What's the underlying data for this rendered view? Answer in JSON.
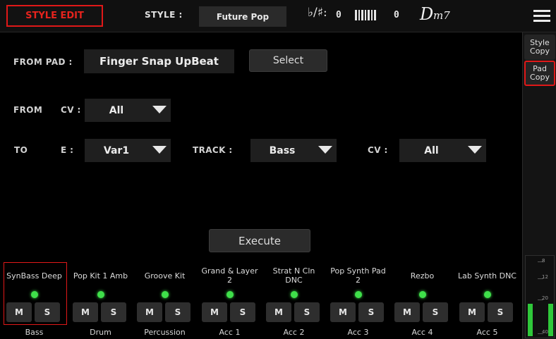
{
  "header": {
    "mode": "STYLE EDIT",
    "style_label": "STYLE :",
    "style_value": "Future Pop",
    "transpose_symbol": "♭/♯:",
    "transpose_value": "0",
    "keyboard_value": "0",
    "chord_root": "D",
    "chord_type": "m7"
  },
  "sidebar": {
    "style_copy": "Style Copy",
    "pad_copy": "Pad Copy",
    "meter_marks": [
      "8",
      "12",
      "20",
      "40"
    ]
  },
  "main": {
    "from_pad_label": "FROM PAD :",
    "from_pad_value": "Finger Snap UpBeat",
    "select_label": "Select",
    "from_label": "FROM",
    "from_cv_label": "CV :",
    "from_cv_value": "All",
    "to_label": "TO",
    "to_e_label": "E :",
    "to_e_value": "Var1",
    "track_label": "TRACK :",
    "track_value": "Bass",
    "to_cv_label": "CV :",
    "to_cv_value": "All",
    "execute_label": "Execute"
  },
  "mixer": {
    "mute_label": "M",
    "solo_label": "S",
    "channels": [
      {
        "name": "SynBass Deep",
        "track": "Bass"
      },
      {
        "name": "Pop Kit 1 Amb",
        "track": "Drum"
      },
      {
        "name": "Groove Kit",
        "track": "Percussion"
      },
      {
        "name": "Grand & Layer 2",
        "track": "Acc 1"
      },
      {
        "name": "Strat N Cln DNC",
        "track": "Acc 2"
      },
      {
        "name": "Pop Synth Pad 2",
        "track": "Acc 3"
      },
      {
        "name": "Rezbo",
        "track": "Acc 4"
      },
      {
        "name": "Lab Synth DNC",
        "track": "Acc 5"
      }
    ]
  },
  "colors": {
    "accent_red": "#e01818",
    "led_green": "#3fe04a",
    "panel": "#1f1f1f"
  }
}
